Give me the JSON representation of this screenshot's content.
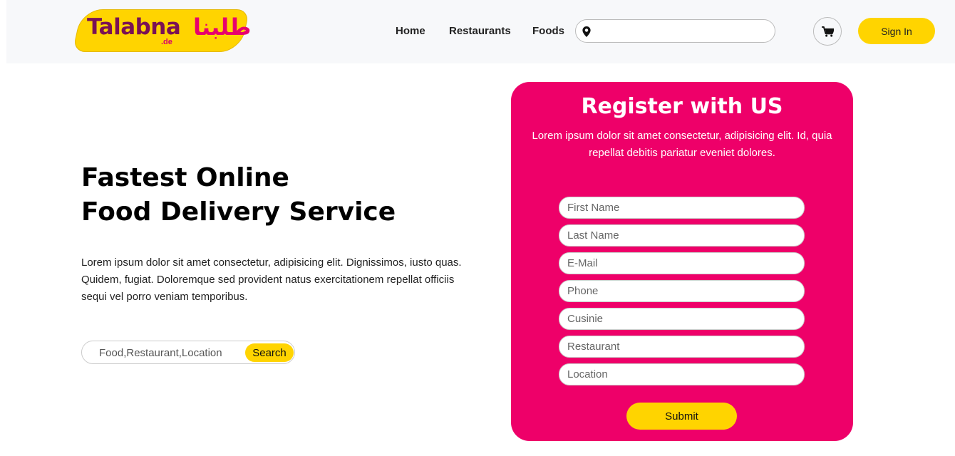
{
  "header": {
    "logo": {
      "brand": "Talabna",
      "tld": ".de",
      "arabic": "طلبنا"
    },
    "nav": [
      {
        "label": "Home"
      },
      {
        "label": "Restaurants"
      },
      {
        "label": "Foods"
      }
    ],
    "location_search": {
      "icon": "map-marker-icon",
      "value": "",
      "placeholder": ""
    },
    "cart": {
      "icon": "shopping-cart-icon"
    },
    "signin_label": "Sign In"
  },
  "hero": {
    "title_line1": "Fastest Online",
    "title_line2": "Food Delivery Service",
    "description": "Lorem ipsum dolor sit amet consectetur, adipisicing elit. Dignissimos, iusto quas. Quidem, fugiat. Doloremque sed provident natus exercitationem repellat officiis sequi vel porro veniam temporibus.",
    "search": {
      "placeholder": "Food,Restaurant,Location",
      "button_label": "Search"
    }
  },
  "register": {
    "title": "Register with US",
    "description": "Lorem ipsum dolor sit amet consectetur, adipisicing elit. Id, quia repellat debitis pariatur eveniet dolores.",
    "fields": [
      {
        "placeholder": "First Name",
        "value": ""
      },
      {
        "placeholder": "Last Name",
        "value": ""
      },
      {
        "placeholder": "E-Mail",
        "value": ""
      },
      {
        "placeholder": "Phone",
        "value": ""
      },
      {
        "placeholder": "Cusinie",
        "value": ""
      },
      {
        "placeholder": "Restaurant",
        "value": ""
      },
      {
        "placeholder": "Location",
        "value": ""
      }
    ],
    "submit_label": "Submit"
  },
  "colors": {
    "accent_yellow": "#ffd400",
    "card_pink": "#ee0069",
    "logo_purple": "#7a1155",
    "header_bg": "#f7f8fa"
  }
}
